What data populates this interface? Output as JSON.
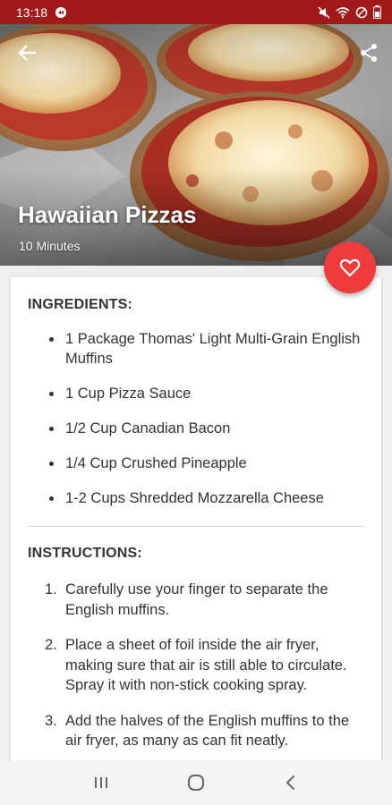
{
  "status_bar": {
    "time": "13:18",
    "icons": [
      "notification-icon",
      "mute-icon",
      "wifi-icon",
      "dnd-icon",
      "battery-icon"
    ]
  },
  "recipe": {
    "title": "Hawaiian Pizzas",
    "time": "10 Minutes"
  },
  "toolbar": {
    "back_icon": "arrow-back-icon",
    "share_icon": "share-icon",
    "favorite_icon": "heart-outline-icon"
  },
  "ingredients": {
    "heading": "INGREDIENTS:",
    "items": [
      "1 Package Thomas' Light Multi-Grain English Muffins",
      "1 Cup Pizza Sauce",
      "1/2 Cup Canadian Bacon",
      "1/4 Cup Crushed Pineapple",
      "1-2 Cups Shredded Mozzarella Cheese"
    ]
  },
  "instructions": {
    "heading": "INSTRUCTIONS:",
    "steps": [
      {
        "num": "1.",
        "text": "Carefully use your finger to separate the English muffins."
      },
      {
        "num": "2.",
        "text": "Place a sheet of foil inside the air fryer, making sure that air is still able to circulate. Spray it with non-stick cooking spray."
      },
      {
        "num": "3.",
        "text": "Add the halves of the English muffins to the air fryer, as many as can fit neatly."
      }
    ]
  },
  "nav_bar": {
    "icons": [
      "recent-apps-icon",
      "home-icon",
      "back-icon"
    ]
  },
  "colors": {
    "status_bar": "#a11a1a",
    "fab": "#ef3b3b",
    "card": "#ffffff",
    "background": "#eeeeee"
  }
}
